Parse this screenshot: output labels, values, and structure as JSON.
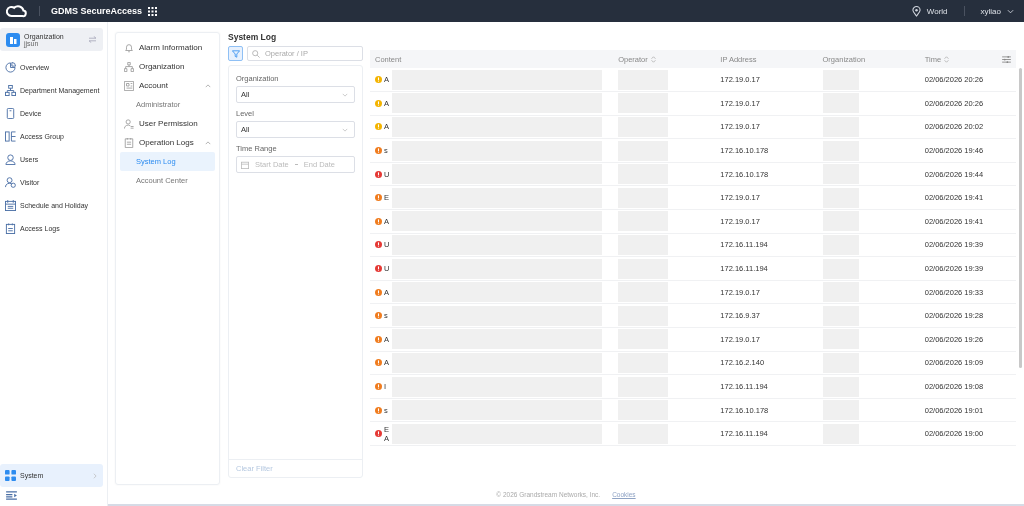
{
  "topbar": {
    "title": "GDMS SecureAccess",
    "region": "World",
    "user": "xyliao"
  },
  "org_switch": {
    "label": "Organization",
    "value": "jjsun"
  },
  "sidebar": {
    "items": [
      {
        "label": "Overview",
        "selected": false
      },
      {
        "label": "Department Management",
        "selected": false
      },
      {
        "label": "Device",
        "selected": false
      },
      {
        "label": "Access Group",
        "selected": false
      },
      {
        "label": "Users",
        "selected": false
      },
      {
        "label": "Visitor",
        "selected": false
      },
      {
        "label": "Schedule and Holiday",
        "selected": false
      },
      {
        "label": "Access Logs",
        "selected": false
      }
    ],
    "bottom_item": {
      "label": "System",
      "selected": true
    }
  },
  "submenu": [
    {
      "label": "Alarm Information"
    },
    {
      "label": "Organization"
    },
    {
      "label": "Account",
      "expanded": true,
      "children": [
        {
          "label": "Administrator",
          "selected": false
        }
      ]
    },
    {
      "label": "User Permission"
    },
    {
      "label": "Operation Logs",
      "expanded": true,
      "children": [
        {
          "label": "System Log",
          "selected": true
        },
        {
          "label": "Account Center",
          "selected": false
        }
      ]
    }
  ],
  "page_title": "System Log",
  "search": {
    "placeholder": "Operator / IP"
  },
  "filters": {
    "organization": {
      "label": "Organization",
      "value": "All"
    },
    "level": {
      "label": "Level",
      "value": "All"
    },
    "time_range": {
      "label": "Time Range",
      "start_placeholder": "Start Date",
      "end_placeholder": "End Date"
    },
    "clear": "Clear Filter"
  },
  "table": {
    "columns": [
      {
        "label": "Content",
        "sortable": false
      },
      {
        "label": "Operator",
        "sortable": true
      },
      {
        "label": "IP Address",
        "sortable": false
      },
      {
        "label": "Organization",
        "sortable": false
      },
      {
        "label": "Time",
        "sortable": true
      }
    ],
    "rows": [
      {
        "kind": "warning",
        "content": [
          "A"
        ],
        "ip": "172.19.0.17",
        "time": "02/06/2026 20:26"
      },
      {
        "kind": "warning",
        "content": [
          "A"
        ],
        "ip": "172.19.0.17",
        "time": "02/06/2026 20:26"
      },
      {
        "kind": "warning",
        "content": [
          "A"
        ],
        "ip": "172.19.0.17",
        "time": "02/06/2026 20:02"
      },
      {
        "kind": "major",
        "content": [
          "s"
        ],
        "ip": "172.16.10.178",
        "time": "02/06/2026 19:46"
      },
      {
        "kind": "critical",
        "content": [
          "U"
        ],
        "ip": "172.16.10.178",
        "time": "02/06/2026 19:44"
      },
      {
        "kind": "major",
        "content": [
          "E"
        ],
        "ip": "172.19.0.17",
        "time": "02/06/2026 19:41"
      },
      {
        "kind": "major",
        "content": [
          "A"
        ],
        "ip": "172.19.0.17",
        "time": "02/06/2026 19:41"
      },
      {
        "kind": "critical",
        "content": [
          "U"
        ],
        "ip": "172.16.11.194",
        "time": "02/06/2026 19:39"
      },
      {
        "kind": "critical",
        "content": [
          "U"
        ],
        "ip": "172.16.11.194",
        "time": "02/06/2026 19:39"
      },
      {
        "kind": "major",
        "content": [
          "A"
        ],
        "ip": "172.19.0.17",
        "time": "02/06/2026 19:33"
      },
      {
        "kind": "major",
        "content": [
          "s"
        ],
        "ip": "172.16.9.37",
        "time": "02/06/2026 19:28"
      },
      {
        "kind": "major",
        "content": [
          "A"
        ],
        "ip": "172.19.0.17",
        "time": "02/06/2026 19:26"
      },
      {
        "kind": "major",
        "content": [
          "A"
        ],
        "ip": "172.16.2.140",
        "time": "02/06/2026 19:09"
      },
      {
        "kind": "major",
        "content": [
          "I"
        ],
        "ip": "172.16.11.194",
        "time": "02/06/2026 19:08"
      },
      {
        "kind": "major",
        "content": [
          "s"
        ],
        "ip": "172.16.10.178",
        "time": "02/06/2026 19:01"
      },
      {
        "kind": "critical",
        "content": [
          "E",
          "A"
        ],
        "ip": "172.16.11.194",
        "time": "02/06/2026 19:00"
      }
    ]
  },
  "footer": {
    "copyright": "© 2026 Grandstream Networks, Inc.",
    "link": "Cookies"
  }
}
